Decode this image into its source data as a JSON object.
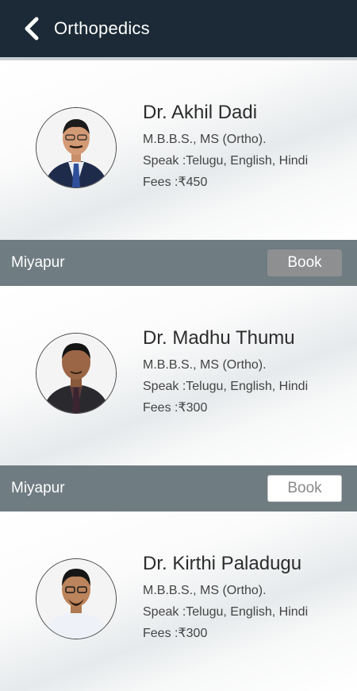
{
  "header": {
    "title": "Orthopedics",
    "back_icon": "chevron-left-icon"
  },
  "doctors": [
    {
      "name": "Dr. Akhil Dadi",
      "qualification": "M.B.B.S., MS (Ortho).",
      "speak": "Speak :Telugu, English, Hindi",
      "fees_label": "Fees :",
      "fees_value": "₹450",
      "location": "Miyapur",
      "book_label": "Book",
      "book_style": "pressed"
    },
    {
      "name": "Dr. Madhu Thumu",
      "qualification": "M.B.B.S., MS (Ortho).",
      "speak": "Speak :Telugu, English, Hindi",
      "fees_label": "Fees :",
      "fees_value": "₹300",
      "location": "Miyapur",
      "book_label": "Book",
      "book_style": "normal"
    },
    {
      "name": "Dr. Kirthi Paladugu",
      "qualification": "M.B.B.S., MS (Ortho).",
      "speak": "Speak :Telugu, English, Hindi",
      "fees_label": "Fees :",
      "fees_value": "₹300"
    }
  ],
  "colors": {
    "appbar": "#1b2a36",
    "location_bar": "#6f7c82",
    "book_pressed": "#8d8f90"
  }
}
